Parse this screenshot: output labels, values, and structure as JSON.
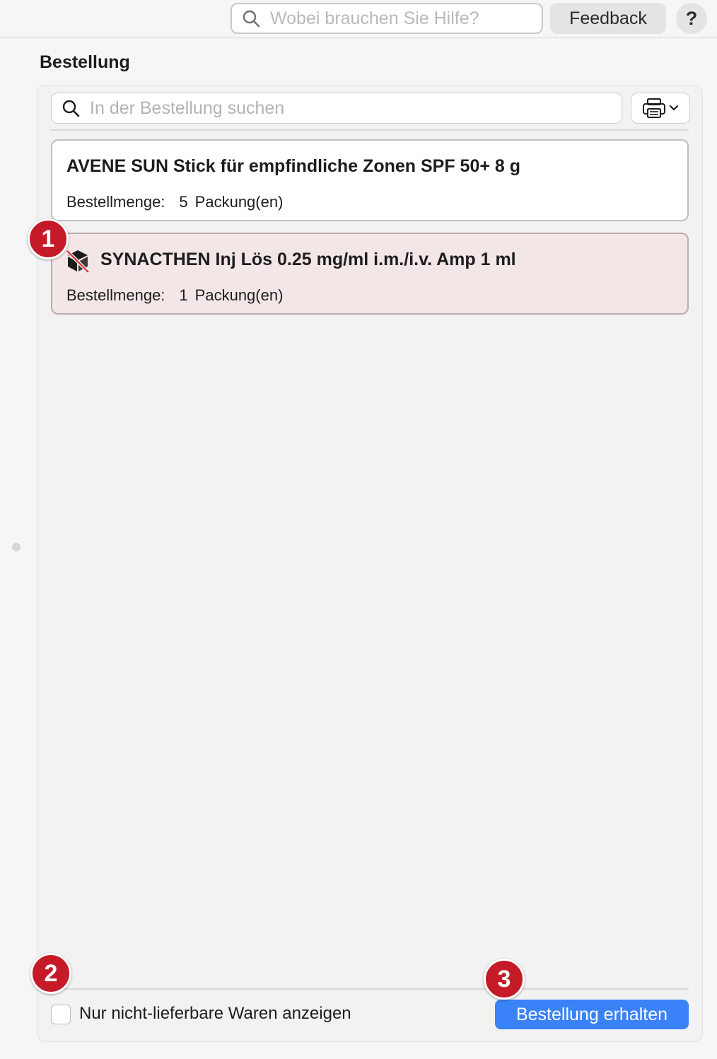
{
  "header": {
    "help_search_placeholder": "Wobei brauchen Sie Hilfe?",
    "feedback_label": "Feedback",
    "help_label": "?"
  },
  "order": {
    "title": "Bestellung",
    "search_placeholder": "In der Bestellung suchen",
    "items": [
      {
        "name": "AVENE SUN Stick für empfindliche Zonen SPF 50+ 8 g",
        "qty_label": "Bestellmenge:",
        "qty": "5",
        "unit": "Packung(en)",
        "flagged": false
      },
      {
        "name": "SYNACTHEN Inj Lös 0.25 mg/ml i.m./i.v. Amp 1 ml",
        "qty_label": "Bestellmenge:",
        "qty": "1",
        "unit": "Packung(en)",
        "flagged": true,
        "icon": "package-unavailable-icon"
      }
    ],
    "filter_label": "Nur nicht-lieferbare Waren anzeigen",
    "filter_checked": false,
    "submit_label": "Bestellung erhalten"
  },
  "annotations": [
    "1",
    "2",
    "3"
  ],
  "colors": {
    "accent": "#3a82f7",
    "badge": "#c51b29",
    "flagged_bg": "#f2e6e6"
  }
}
